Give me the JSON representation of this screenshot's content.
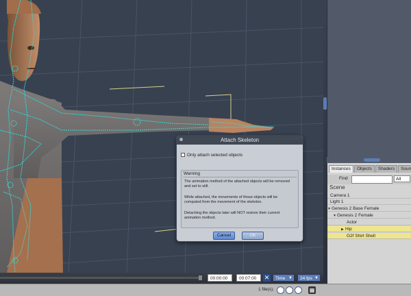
{
  "dialog": {
    "title": "Attach Skeleton",
    "checkbox_label": "Only attach selected objects",
    "warning_label": "Warning",
    "warning_p1": "The animation method of the attached objects will be removed and set to still.",
    "warning_p2": "While attached, the movements of those objects will be computed from the movement of the skeleton.",
    "warning_p3": "Detaching the objects later will NOT restore their current animation method.",
    "cancel_label": "Cancel",
    "ok_label": "Ok"
  },
  "panel": {
    "tabs": [
      "Instances",
      "Objects",
      "Shaders",
      "Sounds"
    ],
    "find_label": "Find",
    "filter_value": "All",
    "scene_header": "Scene",
    "tree": [
      {
        "label": "Camera 1",
        "expanded": false,
        "highlight": false
      },
      {
        "label": "Light 1",
        "expanded": false,
        "highlight": false
      },
      {
        "label": "Genesis 2 Base Female",
        "expanded": true,
        "highlight": false
      },
      {
        "label": "Genesis 2 Female",
        "expanded": true,
        "highlight": false
      },
      {
        "label": "Actor",
        "expanded": false,
        "highlight": false
      },
      {
        "label": "Hip",
        "expanded": false,
        "highlight": true
      },
      {
        "label": "G2f Shirt Shell",
        "expanded": false,
        "highlight": true
      }
    ]
  },
  "timeline": {
    "current_time": "00:00:00",
    "end_time": "00:07:00",
    "time_mode": "Time",
    "fps": "24 fps"
  },
  "status": {
    "files_label": "1 file(s)."
  },
  "colors": {
    "viewport_bg": "#384150",
    "skeleton": "#35d8d8",
    "accent": "#5a7db5",
    "highlight_row": "#efe58a"
  }
}
